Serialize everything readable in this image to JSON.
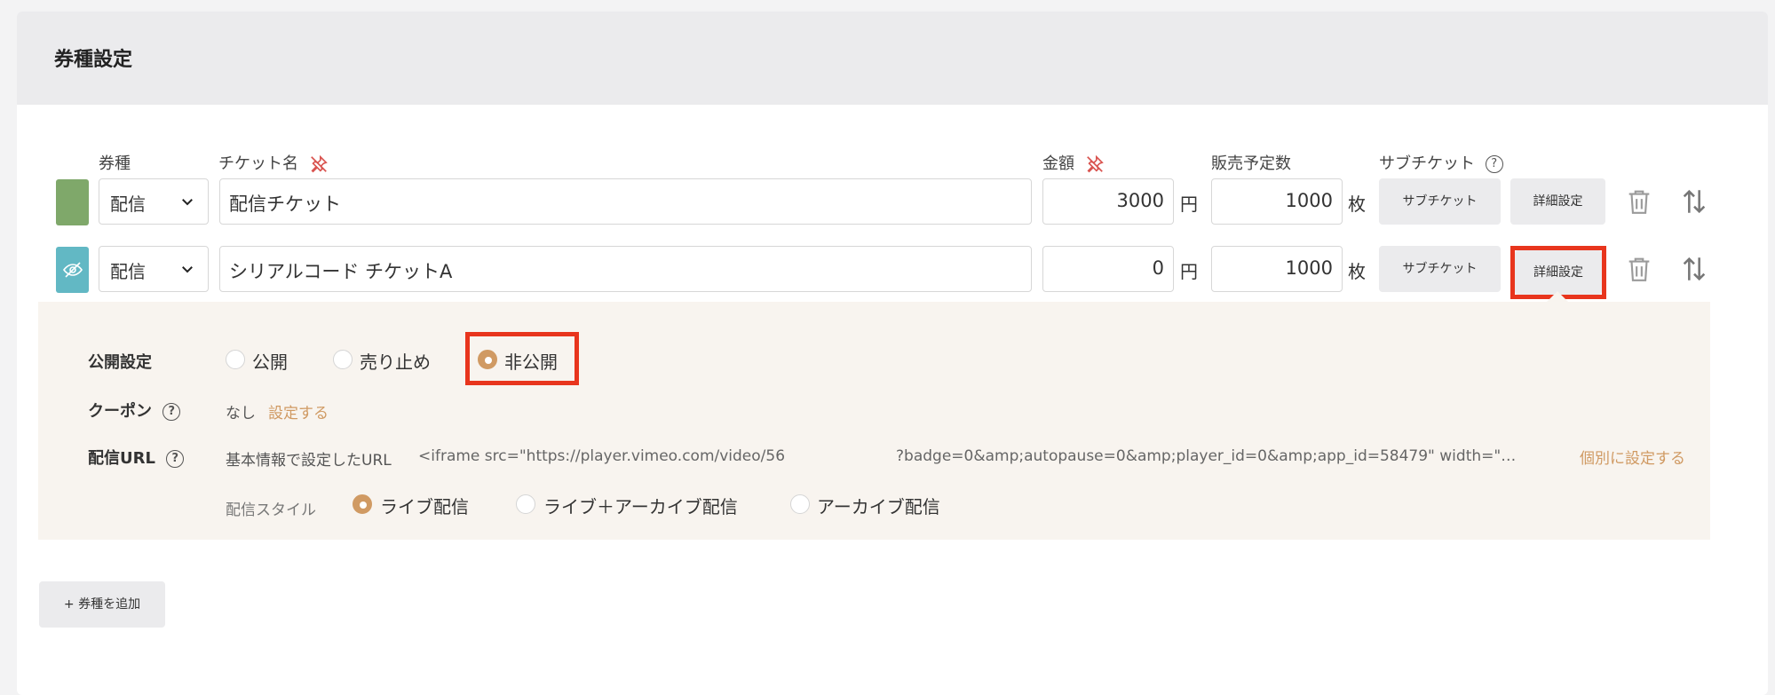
{
  "section": {
    "title": "券種設定"
  },
  "headers": {
    "type": "券種",
    "name": "チケット名",
    "price": "金額",
    "quantity": "販売予定数",
    "subticket": "サブチケット",
    "help": "?"
  },
  "rows": [
    {
      "color": "#7fa86a",
      "type": "配信",
      "name": "配信チケット",
      "price": "3000",
      "price_unit": "円",
      "quantity": "1000",
      "quantity_unit": "枚",
      "subticket_button": "サブチケット",
      "detail_button": "詳細設定"
    },
    {
      "color": "#62b8c4",
      "type": "配信",
      "name": "シリアルコード チケットA",
      "price": "0",
      "price_unit": "円",
      "quantity": "1000",
      "quantity_unit": "枚",
      "subticket_button": "サブチケット",
      "detail_button": "詳細設定"
    }
  ],
  "detail": {
    "visibility": {
      "label": "公開設定",
      "options": [
        "公開",
        "売り止め",
        "非公開"
      ],
      "selected": "非公開"
    },
    "coupon": {
      "label": "クーポン",
      "value": "なし",
      "link": "設定する"
    },
    "stream_url": {
      "label": "配信URL",
      "source": "基本情報で設定したURL",
      "value_part1": "<iframe src=\"https://player.vimeo.com/video/56",
      "value_part2": "?badge=0&amp;autopause=0&amp;player_id=0&amp;app_id=58479\" width=\"…",
      "link": "個別に設定する"
    },
    "stream_style": {
      "label": "配信スタイル",
      "options": [
        "ライブ配信",
        "ライブ＋アーカイブ配信",
        "アーカイブ配信"
      ],
      "selected": "ライブ配信"
    }
  },
  "add_button": "+ 券種を追加",
  "colors": {
    "accent": "#d09a63",
    "highlight": "#e8351d",
    "pin": "#d9534f"
  },
  "icons": [
    "chevron-down-icon",
    "pin-off-icon",
    "eye-off-icon",
    "trash-icon",
    "sort-arrows-icon",
    "help-icon"
  ]
}
